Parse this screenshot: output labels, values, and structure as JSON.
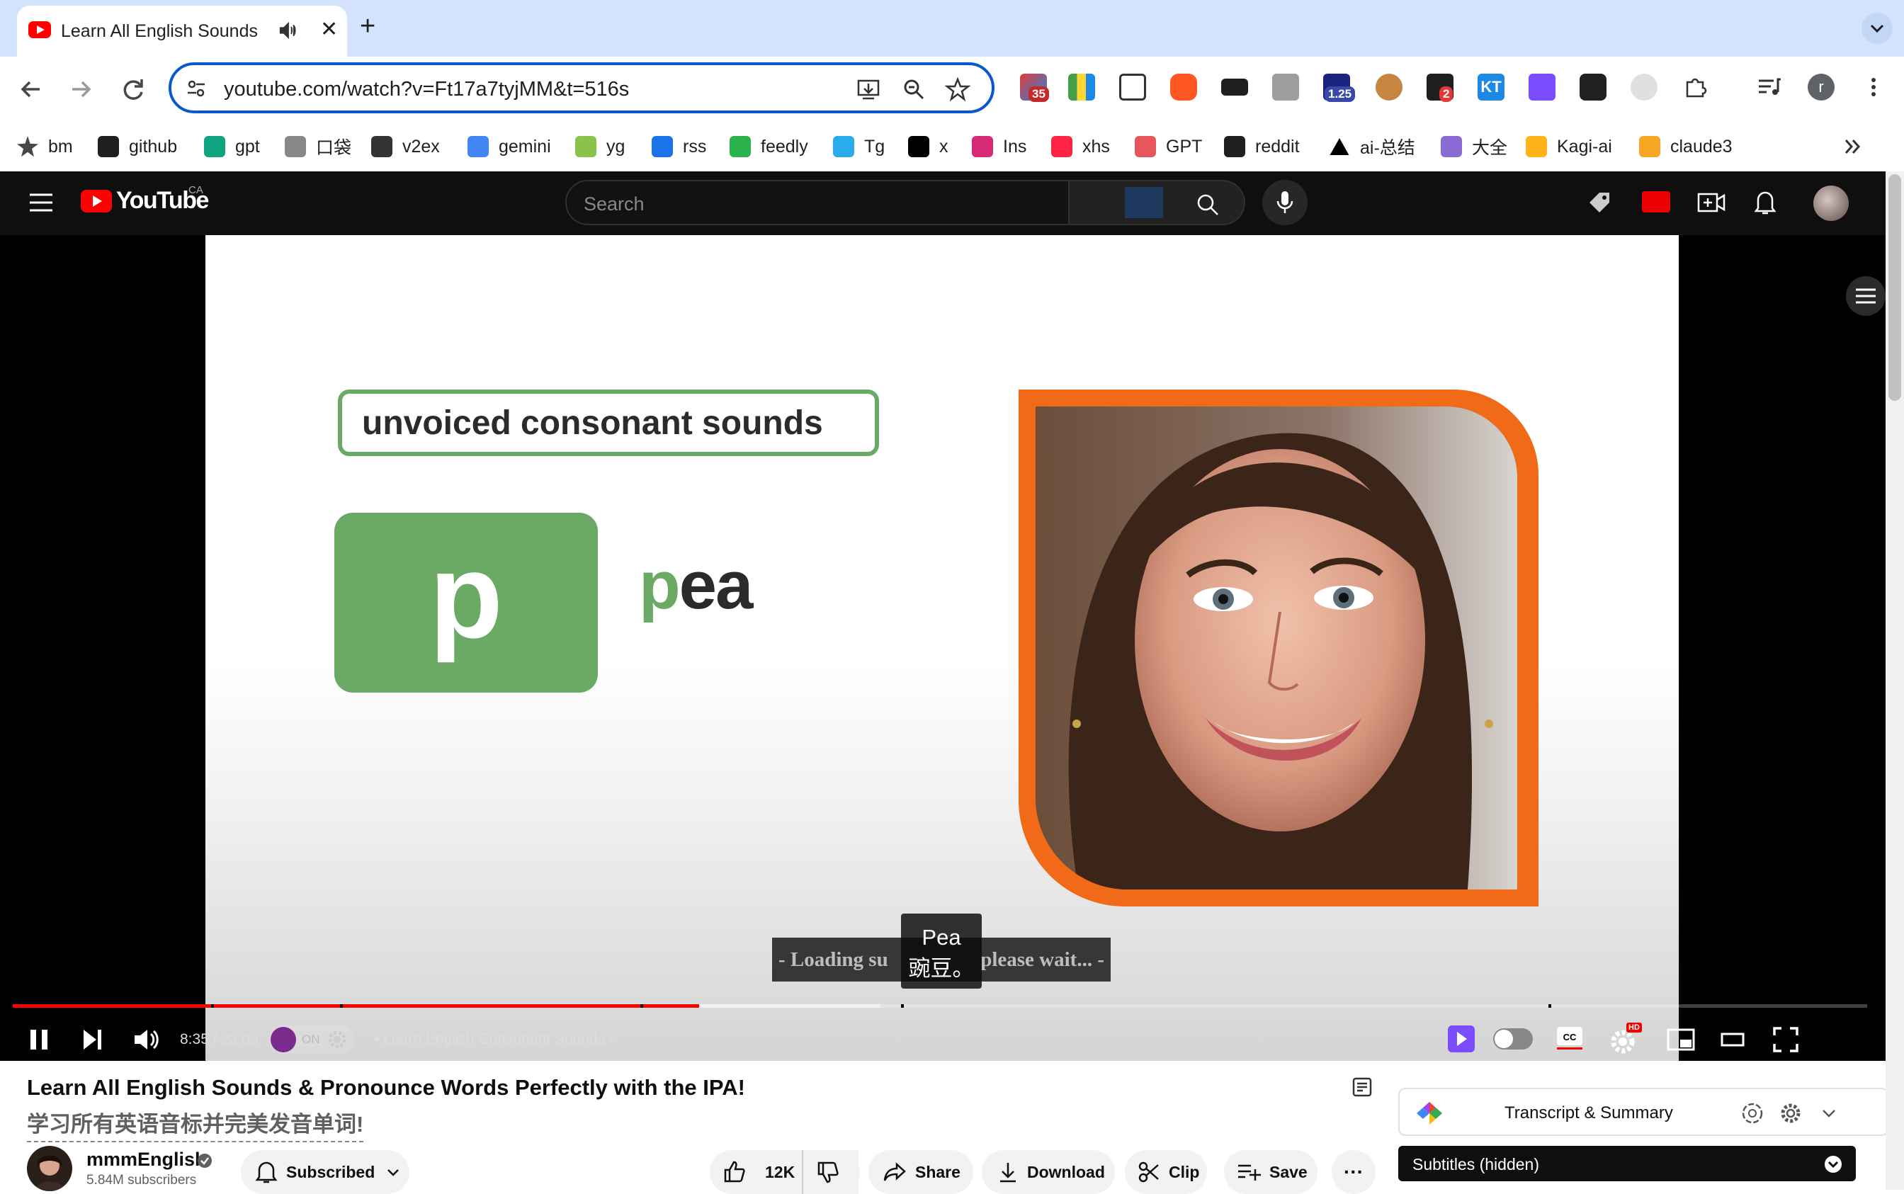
{
  "tab": {
    "title": "Learn All English Sounds",
    "close_glyph": "✕",
    "new_tab_glyph": "+"
  },
  "toolbar": {
    "url": "youtube.com/watch?v=Ft17a7tyjMM&t=516s",
    "ext_badges": {
      "ext1": "35",
      "speed": "1.25",
      "ext_red": "2",
      "kt": "KT"
    }
  },
  "bookmarks": [
    {
      "label": "bm",
      "icon": "star-icon",
      "color": "#474747"
    },
    {
      "label": "github",
      "icon": "github-icon",
      "color": "#1f1f1f"
    },
    {
      "label": "gpt",
      "icon": "openai-icon",
      "color": "#10a37f"
    },
    {
      "label": "口袋",
      "icon": "pocket-icon",
      "color": "#888888"
    },
    {
      "label": "v2ex",
      "icon": "v2ex-icon",
      "color": "#333333"
    },
    {
      "label": "gemini",
      "icon": "gemini-icon",
      "color": "#4285f4"
    },
    {
      "label": "yg",
      "icon": "yg-icon",
      "color": "#8bc34a"
    },
    {
      "label": "rss",
      "icon": "rss-icon",
      "color": "#1a73e8"
    },
    {
      "label": "feedly",
      "icon": "feedly-icon",
      "color": "#2bb24c"
    },
    {
      "label": "Tg",
      "icon": "telegram-icon",
      "color": "#2aabee"
    },
    {
      "label": "x",
      "icon": "x-icon",
      "color": "#000000"
    },
    {
      "label": "Ins",
      "icon": "instagram-icon",
      "color": "#d62976"
    },
    {
      "label": "xhs",
      "icon": "xiaohongshu-icon",
      "color": "#ff2442"
    },
    {
      "label": "GPT",
      "icon": "gpt-swirl-icon",
      "color": "#e8555a"
    },
    {
      "label": "reddit",
      "icon": "reddit-l-icon",
      "color": "#1f1f1f"
    },
    {
      "label": "ai-总结",
      "icon": "triangle-icon",
      "color": "#000000"
    },
    {
      "label": "大全",
      "icon": "play-outline-icon",
      "color": "#8a6bd6"
    },
    {
      "label": "Kagi-ai",
      "icon": "kagi-icon",
      "color": "#ffb319"
    },
    {
      "label": "claude3",
      "icon": "claude-icon",
      "color": "#f5a623"
    }
  ],
  "youtube": {
    "logo_text": "YouTube",
    "country": "CA",
    "search_placeholder": "Search"
  },
  "video": {
    "heading": "unvoiced consonant sounds",
    "letter": "p",
    "word_first": "p",
    "word_rest": "ea",
    "subtitle_loading": "- Loading su",
    "subtitle_loading_tail": "please wait... -",
    "subtitle_en": "Pea",
    "subtitle_zh": "豌豆。"
  },
  "player": {
    "time_current": "8:35",
    "time_total": "23:09",
    "on_label": "ON",
    "chapter": "• Learn English Consonant Sounds",
    "progress_played": 0.37,
    "progress_buffered": 0.468,
    "hd_badge": "HD"
  },
  "info": {
    "title": "Learn All English Sounds & Pronounce Words Perfectly with the IPA!",
    "title_zh": "学习所有英语音标并完美发音单词!",
    "channel": "mmmEnglish",
    "subscribers": "5.84M subscribers",
    "subscribed_label": "Subscribed",
    "likes": "12K",
    "share_label": "Share",
    "download_label": "Download",
    "clip_label": "Clip",
    "save_label": "Save",
    "more_glyph": "···"
  },
  "sidebar": {
    "transcript_label": "Transcript & Summary",
    "subtitles_label": "Subtitles (hidden)"
  }
}
